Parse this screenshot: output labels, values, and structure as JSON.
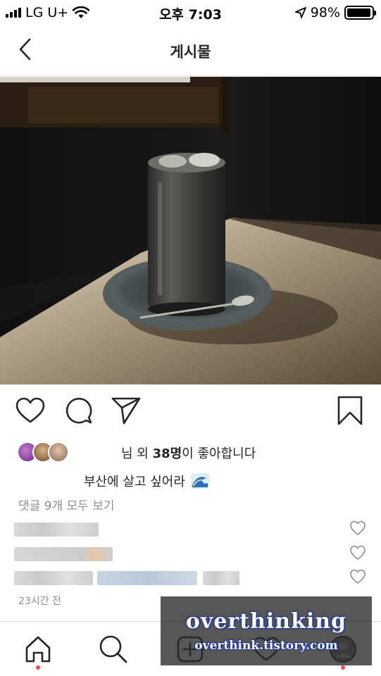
{
  "status_bar": {
    "carrier": "LG U+",
    "time": "오후 7:03",
    "battery_percent": "98%",
    "battery_level": 0.98
  },
  "header": {
    "title": "게시물",
    "back_icon": "chevron-left-icon"
  },
  "post": {
    "photo_description_icon": "photo",
    "likes_prefix": "님 외 ",
    "likes_count": "38명",
    "likes_suffix": "이 좋아합니다",
    "caption": "부산에 살고 싶어라",
    "caption_emoji": "wave-icon",
    "view_comments": "댓글 9개 모두 보기",
    "timestamp": "23시간 전"
  },
  "actions": {
    "like_icon": "heart-icon",
    "comment_icon": "comment-icon",
    "share_icon": "send-icon",
    "save_icon": "bookmark-icon"
  },
  "tab_bar": {
    "items": [
      "home-icon",
      "search-icon",
      "add-icon",
      "activity-heart-icon",
      "profile-icon"
    ]
  },
  "watermark": {
    "title": "overthinking",
    "url": "overthink.tistory.com"
  },
  "colors": {
    "notification_dot": "#ed4956",
    "secondary_text": "#8e8e8e",
    "primary_text": "#262626"
  }
}
